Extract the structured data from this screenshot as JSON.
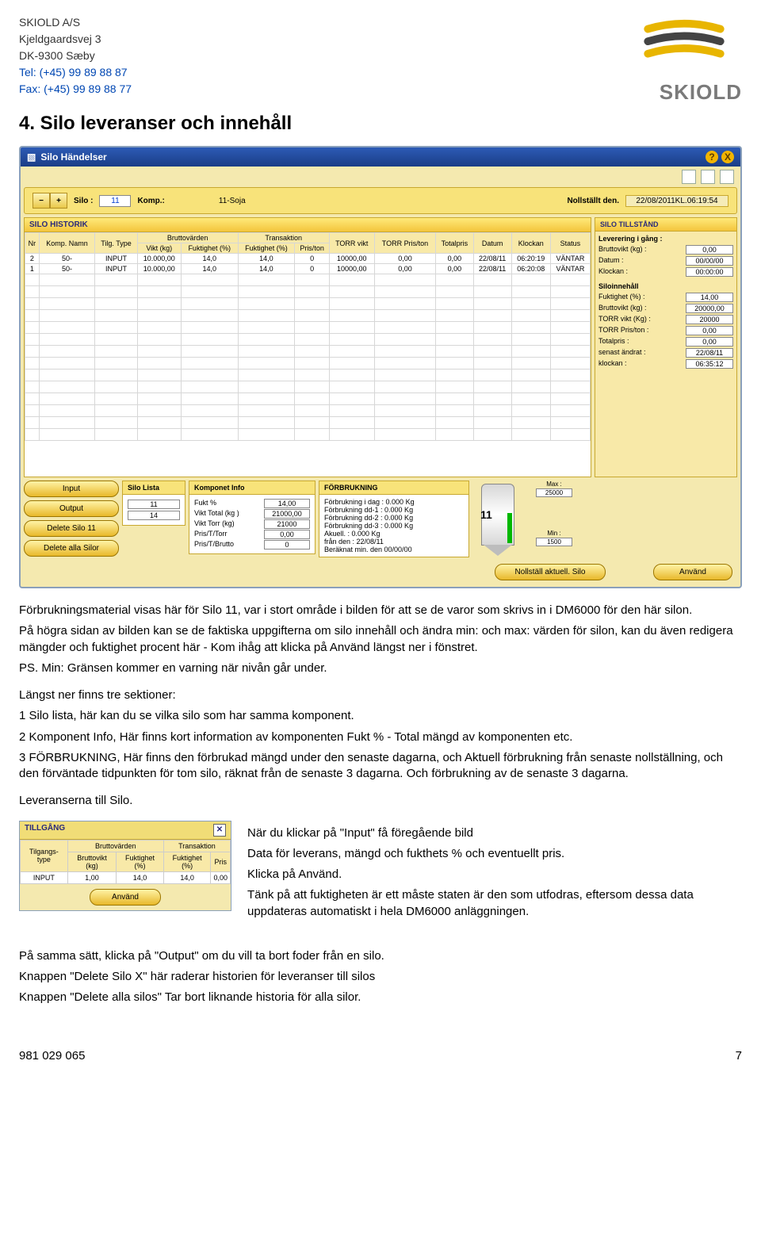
{
  "header": {
    "company": "SKIOLD A/S",
    "street": "Kjeldgaardsvej 3",
    "postal": "DK-9300 Sæby",
    "tel_label": "Tel: (+45) 99 89 88 87",
    "fax_label": "Fax: (+45) 99 89 88 77",
    "brand": "SKIOLD"
  },
  "section_title": "4. Silo leveranser och innehåll",
  "app": {
    "title": "Silo Händelser",
    "help_glyph": "?",
    "close_glyph": "X",
    "selector": {
      "minus": "−",
      "plus": "+",
      "silo_label": "Silo :",
      "silo_value": "11",
      "komp_label": "Komp.:",
      "komp_value": "11-Soja",
      "nollstallt_label": "Nollställt den.",
      "nollstallt_value": "22/08/2011KL.06:19:54"
    },
    "hist_title": "SILO HISTORIK",
    "hist_cols": {
      "nr": "Nr",
      "komp": "Komp. Namn",
      "tilg": "Tilg. Type",
      "brutto_grp": "Bruttovärden",
      "trans_grp": "Transaktion",
      "vikt": "Vikt (kg)",
      "fukt_pct": "Fuktighet (%)",
      "fukt_pct2": "Fuktighet (%)",
      "pris_ton": "Pris/ton",
      "torr_vikt": "TORR vikt",
      "torr_pris": "TORR Pris/ton",
      "tot": "Totalpris",
      "datum": "Datum",
      "klockan": "Klockan",
      "status": "Status"
    },
    "hist_rows": [
      {
        "nr": "2",
        "komp": "50-",
        "tilg": "INPUT",
        "vikt": "10.000,00",
        "f1": "14,0",
        "f2": "14,0",
        "pt": "0",
        "tv": "10000,00",
        "tp": "0,00",
        "tot": "0,00",
        "d": "22/08/11",
        "k": "06:20:19",
        "s": "VÄNTAR"
      },
      {
        "nr": "1",
        "komp": "50-",
        "tilg": "INPUT",
        "vikt": "10.000,00",
        "f1": "14,0",
        "f2": "14,0",
        "pt": "0",
        "tv": "10000,00",
        "tp": "0,00",
        "tot": "0,00",
        "d": "22/08/11",
        "k": "06:20:08",
        "s": "VÄNTAR"
      }
    ],
    "status": {
      "title": "SILO TILLSTÅND",
      "lev_label": "Leverering i gång :",
      "bruttovikt_l": "Bruttovikt (kg) :",
      "bruttovikt_v": "0,00",
      "datum_l": "Datum :",
      "datum_v": "00/00/00",
      "klockan_l": "Klockan :",
      "klockan_v": "00:00:00",
      "siloinne_label": "Siloinnehåll",
      "fukt_l": "Fuktighet (%) :",
      "fukt_v": "14,00",
      "bv_l": "Bruttovikt (kg) :",
      "bv_v": "20000,00",
      "torr_l": "TORR vikt (Kg) :",
      "torr_v": "20000",
      "torrpris_l": "TORR Pris/ton :",
      "torrpris_v": "0,00",
      "totpris_l": "Totalpris :",
      "totpris_v": "0,00",
      "senast_l": "senast ändrat :",
      "senast_v": "22/08/11",
      "kl_l": "klockan :",
      "kl_v": "06:35:12"
    },
    "buttons": {
      "input": "Input",
      "output": "Output",
      "delsilo": "Delete Silo 11",
      "delall": "Delete alla Silor",
      "nollstall": "Nollställ aktuell. Silo",
      "anvand": "Använd"
    },
    "silo_lista": {
      "title": "Silo Lista",
      "items": [
        "11",
        "14"
      ]
    },
    "komp_info": {
      "title": "Komponet Info",
      "rows": [
        {
          "l": "Fukt %",
          "v": "14,00"
        },
        {
          "l": "Vikt Total (kg )",
          "v": "21000,00"
        },
        {
          "l": "Vikt Torr (kg)",
          "v": "21000"
        },
        {
          "l": "Pris/T/Torr",
          "v": "0,00"
        },
        {
          "l": "Pris/T/Brutto",
          "v": "0"
        }
      ]
    },
    "forbruk": {
      "title": "FÖRBRUKNING",
      "rows": [
        "Förbrukning i dag :   0.000 Kg",
        "Förbrukning dd-1 :   0.000 Kg",
        "Förbrukning dd-2 :   0.000 Kg",
        "Förbrukning dd-3 :   0.000 Kg",
        "Akuell. : 0.000 Kg",
        "från den : 22/08/11",
        "Beräknat min. den   00/00/00"
      ]
    },
    "silo_img": {
      "label": "11",
      "max_l": "Max :",
      "max_v": "25000",
      "min_l": "Min :",
      "min_v": "1500"
    }
  },
  "body": {
    "p1": "Förbrukningsmaterial visas här för Silo 11, var i stort område i bilden för att se de varor som skrivs in i DM6000 för den här silon.",
    "p2": "På högra sidan av bilden kan se de faktiska uppgifterna om silo innehåll och ändra min: och max: värden för silon, kan du även redigera mängder och fuktighet procent här - Kom ihåg att klicka på Använd längst ner i fönstret.",
    "p3": "PS. Min: Gränsen kommer en varning när nivån går under.",
    "p4": "Längst ner finns tre sektioner:",
    "l1": "1 Silo lista, här kan du se vilka silo som har samma komponent.",
    "l2": "2 Komponent Info, Här finns kort information av komponenten Fukt % - Total mängd av komponenten etc.",
    "l3": "3 FÖRBRUKNING, Här finns den förbrukad mängd under den senaste dagarna, och Aktuell förbrukning från senaste nollställning, och den förväntade tidpunkten för tom silo, räknat från de senaste 3 dagarna. Och förbrukning av de senaste 3 dagarna.",
    "lev_title": "Leveranserna till Silo.",
    "r1": "När du klickar på \"Input\" få föregående bild",
    "r2": "Data för leverans, mängd och fukthets % och eventuellt pris.",
    "r3": "Klicka på Använd.",
    "r4": "Tänk på att fuktigheten är ett måste staten är den som utfodras, eftersom dessa data uppdateras automatiskt i hela DM6000 anläggningen.",
    "f1": "På samma sätt, klicka på \"Output\" om du vill ta bort foder från en silo.",
    "f2": "Knappen \"Delete Silo X\" här raderar historien för leveranser till silos",
    "f3": "Knappen \"Delete alla silos\" Tar bort liknande historia för alla silor."
  },
  "tillgang": {
    "title": "TILLGÅNG",
    "cols": {
      "typ": "Tilgangs-type",
      "brutto_grp": "Bruttovärden",
      "trans_grp": "Transaktion",
      "brutto": "Bruttovikt (kg)",
      "f1": "Fuktighet (%)",
      "f2": "Fuktighet (%)",
      "pris": "Pris"
    },
    "row": {
      "typ": "INPUT",
      "b": "1,00",
      "f1": "14,0",
      "f2": "14,0",
      "p": "0,00"
    },
    "anvand": "Använd"
  },
  "footer": {
    "left": "981 029 065",
    "right": "7"
  }
}
